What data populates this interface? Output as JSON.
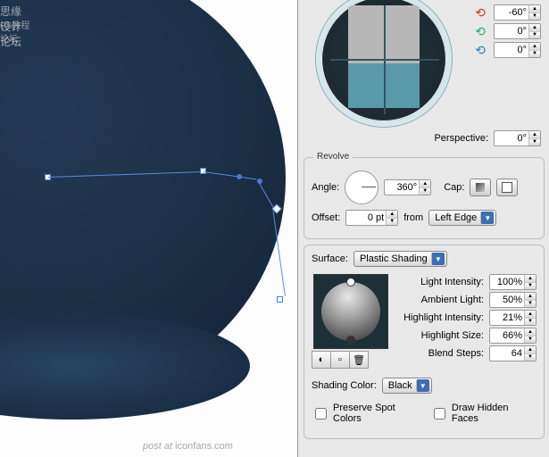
{
  "rotation": {
    "x": "-60°",
    "y": "0°",
    "z": "0°"
  },
  "perspective": {
    "label": "Perspective:",
    "value": "0°"
  },
  "revolve": {
    "title": "Revolve",
    "angle_label": "Angle:",
    "angle": "360°",
    "cap_label": "Cap:",
    "offset_label": "Offset:",
    "offset": "0 pt",
    "from_label": "from",
    "from": "Left Edge"
  },
  "surface": {
    "label": "Surface:",
    "value": "Plastic Shading",
    "light_intensity_label": "Light Intensity:",
    "light_intensity": "100%",
    "ambient_label": "Ambient Light:",
    "ambient": "50%",
    "highlight_intensity_label": "Highlight Intensity:",
    "highlight_intensity": "21%",
    "highlight_size_label": "Highlight Size:",
    "highlight_size": "66%",
    "blend_steps_label": "Blend Steps:",
    "blend_steps": "64",
    "shading_color_label": "Shading Color:",
    "shading_color": "Black",
    "preserve_spot": "Preserve Spot Colors",
    "draw_hidden": "Draw Hidden Faces"
  },
  "watermark": {
    "post": "post at",
    "site": "iconfans.com",
    "sig": ""
  },
  "topright": {
    "a": "思缘设计论坛",
    "b": "PS教程论坛"
  }
}
